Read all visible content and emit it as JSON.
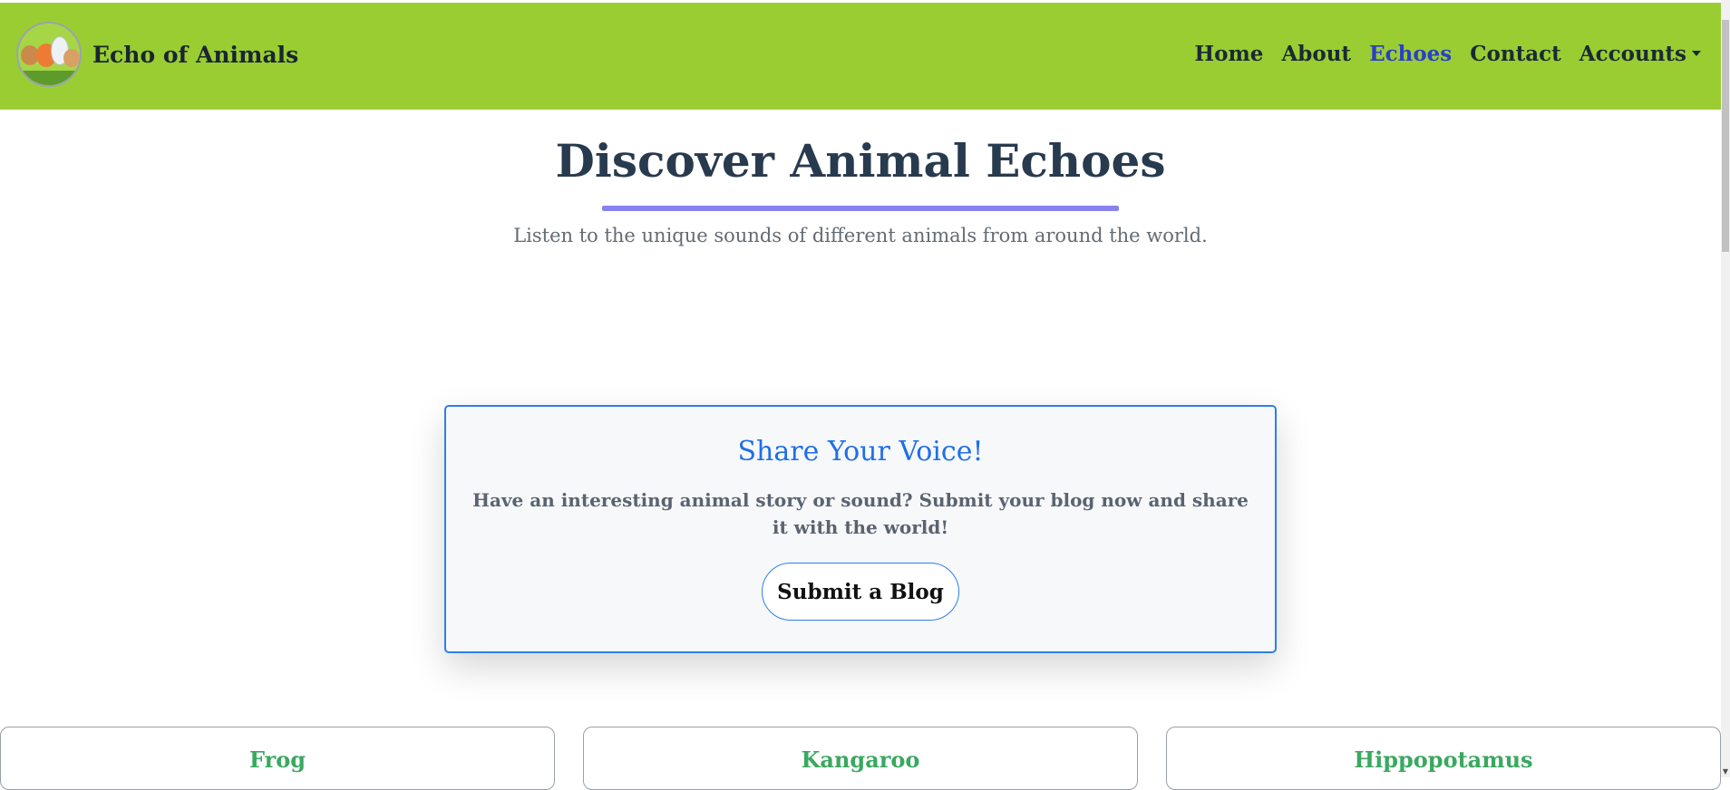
{
  "brand": {
    "name": "Echo of Animals"
  },
  "nav": {
    "items": [
      {
        "label": "Home",
        "active": false
      },
      {
        "label": "About",
        "active": false
      },
      {
        "label": "Echoes",
        "active": true
      },
      {
        "label": "Contact",
        "active": false
      },
      {
        "label": "Accounts",
        "active": false,
        "dropdown": true
      }
    ]
  },
  "hero": {
    "title": "Discover Animal Echoes",
    "subtitle": "Listen to the unique sounds of different animals from around the world."
  },
  "share": {
    "title": "Share Your Voice!",
    "text": "Have an interesting animal story or sound? Submit your blog now and share it with the world!",
    "button_label": "Submit a Blog"
  },
  "animals": [
    {
      "name": "Frog"
    },
    {
      "name": "Kangaroo"
    },
    {
      "name": "Hippopotamus"
    }
  ],
  "colors": {
    "navbar_bg": "#9acd32",
    "active_link": "#2a3fc9",
    "accent_blue": "#1f6fe8",
    "underline": "#8882f0",
    "animal_title": "#3aa860"
  }
}
